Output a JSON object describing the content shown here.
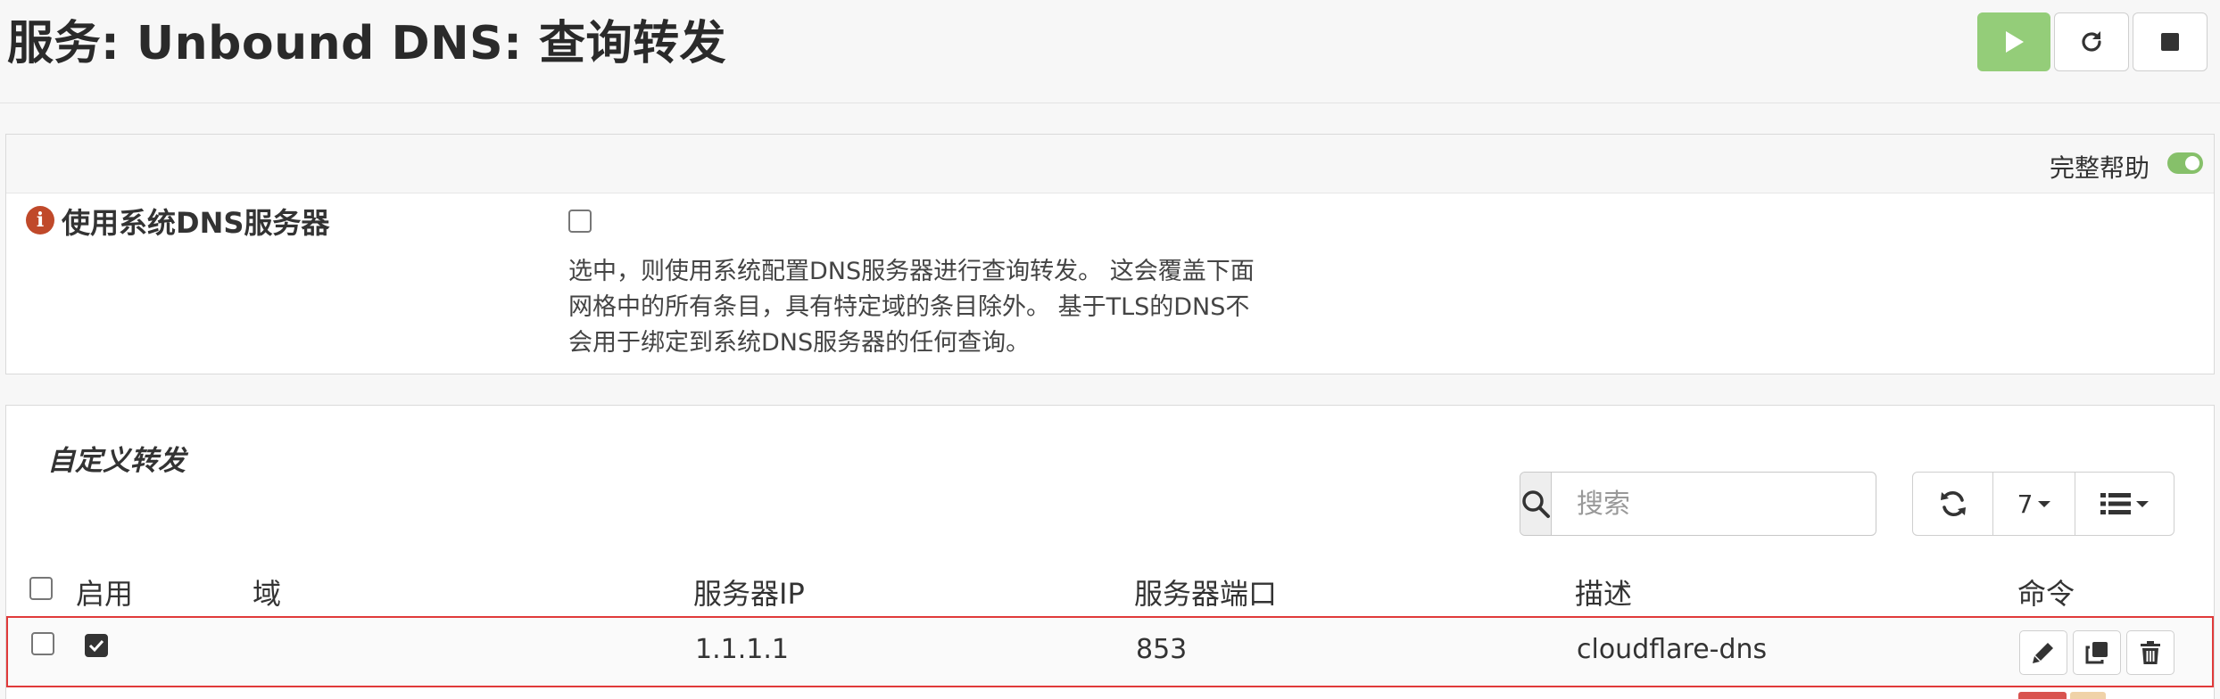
{
  "header": {
    "title": "服务: Unbound DNS: 查询转发",
    "buttons": [
      {
        "name": "start-service-button",
        "icon": "play-icon",
        "color": "#94cd79"
      },
      {
        "name": "restart-service-button",
        "icon": "refresh-icon"
      },
      {
        "name": "stop-service-button",
        "icon": "stop-icon"
      }
    ]
  },
  "settings": {
    "full_help_label": "完整帮助",
    "full_help_enabled": true,
    "use_system_dns": {
      "label": "使用系统DNS服务器",
      "checked": false,
      "help_lines": [
        "选中，则使用系统配置DNS服务器进行查询转发。 这会覆盖下面",
        "网格中的所有条目，具有特定域的条目除外。 基于TLS的DNS不",
        "会用于绑定到系统DNS服务器的任何查询。"
      ]
    }
  },
  "custom_forwarding": {
    "title": "自定义转发",
    "search": {
      "placeholder": "搜索",
      "value": ""
    },
    "page_size": "7",
    "columns": [
      "启用",
      "域",
      "服务器IP",
      "服务器端口",
      "描述",
      "命令"
    ],
    "rows": [
      {
        "selected": false,
        "enabled": true,
        "domain": "",
        "server_ip": "1.1.1.1",
        "server_port": "853",
        "description": "cloudflare-dns"
      }
    ]
  },
  "colors": {
    "accent_green": "#94cd79",
    "highlight_border": "#e03a3a",
    "info_icon": "#c0492a"
  }
}
